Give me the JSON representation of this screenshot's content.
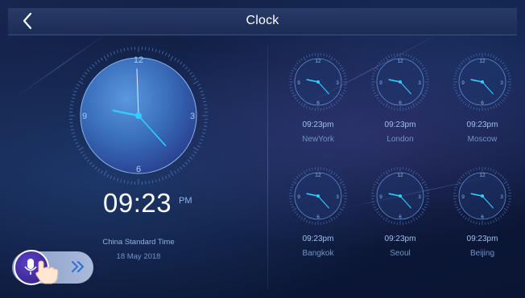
{
  "header": {
    "title": "Clock",
    "back_icon": "chevron-left-icon"
  },
  "main_clock": {
    "time": "09:23",
    "ampm": "PM",
    "timezone": "China Standard Time",
    "date": "18 May 2018",
    "dial_numbers": [
      "12",
      "3",
      "6",
      "9"
    ],
    "hour": 9,
    "minute": 23
  },
  "world_clocks": [
    {
      "time": "09:23pm",
      "city": "NewYork"
    },
    {
      "time": "09:23pm",
      "city": "London"
    },
    {
      "time": "09:23pm",
      "city": "Moscow"
    },
    {
      "time": "09:23pm",
      "city": "Bangkok"
    },
    {
      "time": "09:23pm",
      "city": "Seoul"
    },
    {
      "time": "09:23pm",
      "city": "Beijing"
    }
  ],
  "voice_assistant": {
    "mic_icon": "microphone-icon",
    "expand_icon": "double-chevron-right-icon",
    "hand_icon": "pointing-hand-icon"
  },
  "colors": {
    "accent": "#39c6f0",
    "header_bg": "#24365f",
    "text_secondary": "#8fb3e8"
  }
}
